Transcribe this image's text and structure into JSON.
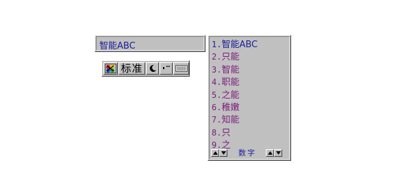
{
  "composition": {
    "text": "智能ABC"
  },
  "status_bar": {
    "mode_label": "标准",
    "logo_icon": "ime-logo-icon",
    "moon_icon": "half-width-moon-icon",
    "punct_icon": "punctuation-icon",
    "keyboard_icon": "soft-keyboard-icon"
  },
  "candidates": {
    "items": [
      {
        "num": "1.",
        "text": "智能ABC"
      },
      {
        "num": "2.",
        "text": "只能"
      },
      {
        "num": "3.",
        "text": "智能"
      },
      {
        "num": "4.",
        "text": "职能"
      },
      {
        "num": "5.",
        "text": "之能"
      },
      {
        "num": "6.",
        "text": "稚嫩"
      },
      {
        "num": "7.",
        "text": "知能"
      },
      {
        "num": "8.",
        "text": "只"
      },
      {
        "num": "9.",
        "text": "之"
      }
    ],
    "footer_label": "数字"
  },
  "colors": {
    "window_face": "#c0c0c0",
    "first_candidate": "#1c1c9a",
    "candidate_text": "#7a1c7a"
  }
}
